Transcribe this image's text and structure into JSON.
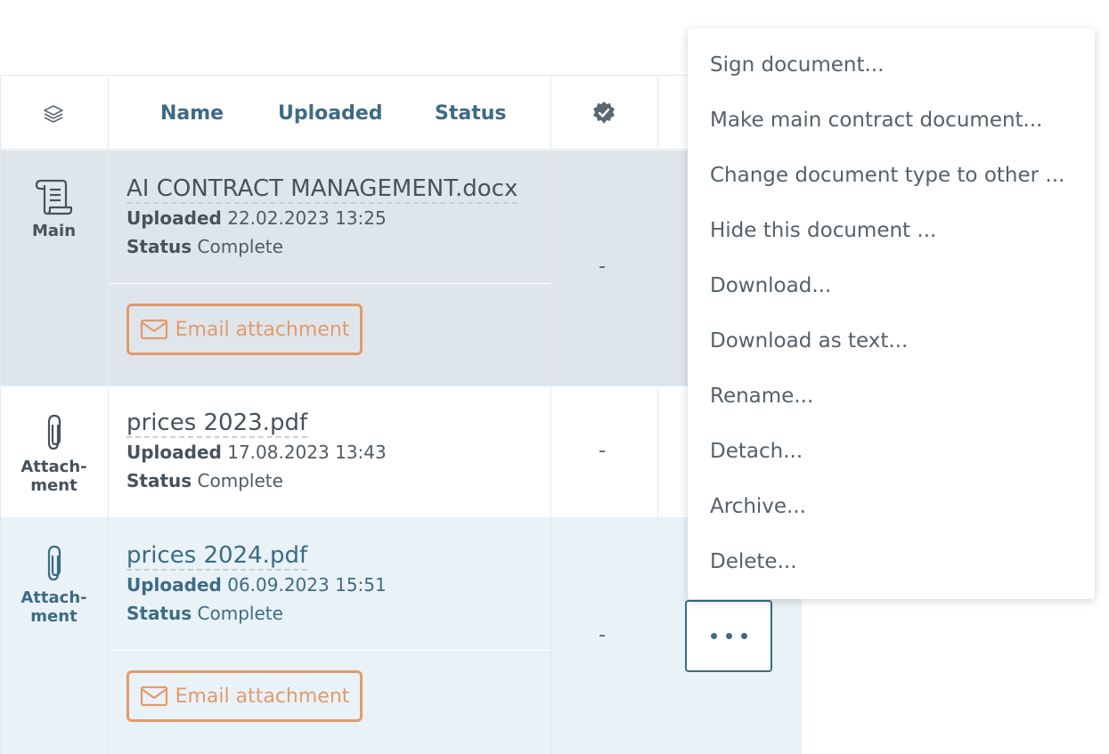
{
  "header": {
    "name_label": "Name",
    "uploaded_label": "Uploaded",
    "status_label": "Status"
  },
  "rows": [
    {
      "type_label": "Main",
      "file_name": "AI CONTRACT MANAGEMENT.docx",
      "uploaded_label": "Uploaded",
      "uploaded_value": "22.02.2023 13:25",
      "status_label": "Status",
      "status_value": "Complete",
      "signed": "-",
      "email_button": "Email attachment"
    },
    {
      "type_label": "Attach-\nment",
      "file_name": "prices 2023.pdf",
      "uploaded_label": "Uploaded",
      "uploaded_value": "17.08.2023 13:43",
      "status_label": "Status",
      "status_value": "Complete",
      "signed": "-"
    },
    {
      "type_label": "Attach-\nment",
      "file_name": "prices 2024.pdf",
      "uploaded_label": "Uploaded",
      "uploaded_value": "06.09.2023 15:51",
      "status_label": "Status",
      "status_value": "Complete",
      "signed": "-",
      "email_button": "Email attachment"
    }
  ],
  "context_menu": {
    "items": [
      "Sign document...",
      "Make main contract document...",
      "Change document type to other ...",
      "Hide this document ...",
      "Download...",
      "Download as text...",
      "Rename...",
      "Detach...",
      "Archive...",
      "Delete..."
    ]
  },
  "icons": {
    "header_type": "layers-icon",
    "header_signed": "verified-badge-icon",
    "main_type": "scroll-document-icon",
    "attachment_type": "paperclip-icon",
    "email": "envelope-icon",
    "more": "more-dots-icon"
  },
  "colors": {
    "accent": "#3d6b85",
    "email": "#e39a6c",
    "row_main_bg": "#dfe6eb",
    "row_selected_bg": "#e9f2f7"
  }
}
